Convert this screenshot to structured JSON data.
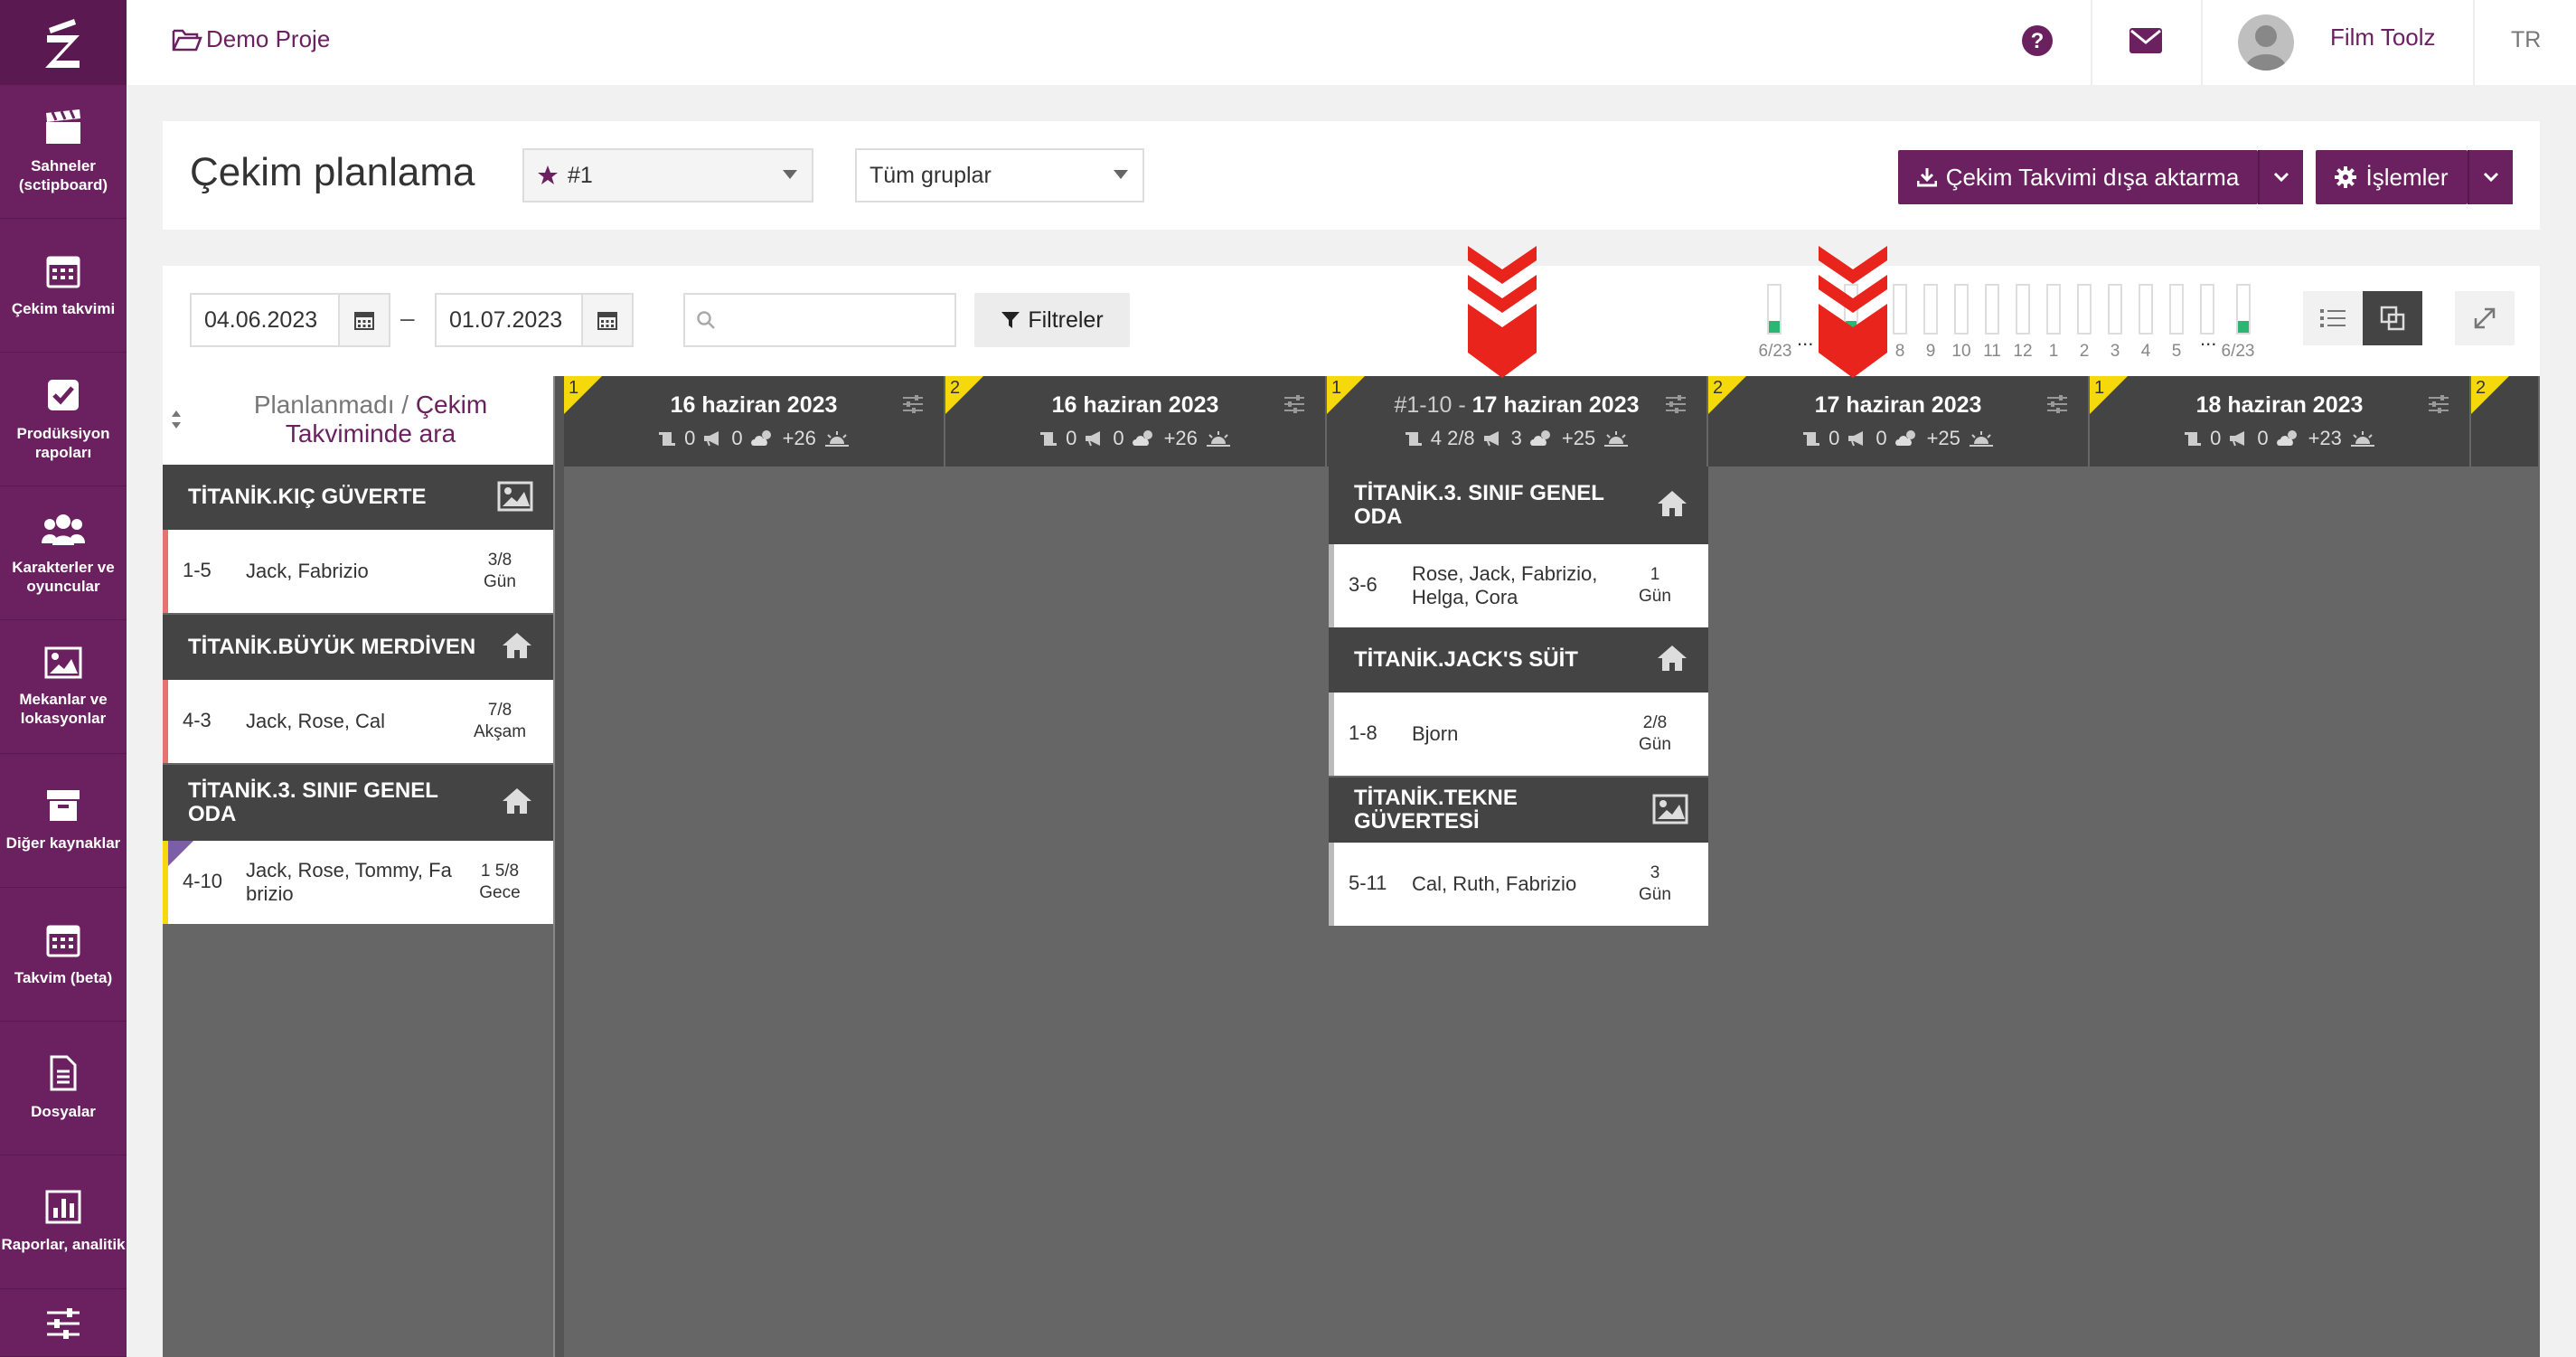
{
  "sidebar": {
    "items": [
      {
        "label": "Sahneler (sctipboard)",
        "icon": "clapperboard-icon"
      },
      {
        "label": "Çekim takvimi",
        "icon": "calendar-icon"
      },
      {
        "label": "Prodüksiyon rapoları",
        "icon": "checkbox-icon"
      },
      {
        "label": "Karakterler ve oyuncular",
        "icon": "users-icon"
      },
      {
        "label": "Mekanlar ve lokasyonlar",
        "icon": "image-icon"
      },
      {
        "label": "Diğer kaynaklar",
        "icon": "archive-icon"
      },
      {
        "label": "Takvim (beta)",
        "icon": "calendar-icon"
      },
      {
        "label": "Dosyalar",
        "icon": "file-icon"
      },
      {
        "label": "Raporlar, analitik",
        "icon": "bar-chart-icon"
      },
      {
        "label": "",
        "icon": "sliders-icon"
      }
    ]
  },
  "topbar": {
    "project": "Demo Proje",
    "username": "Film Toolz",
    "language": "TR"
  },
  "header": {
    "title": "Çekim planlama",
    "schedule_select": "#1",
    "group_select": "Tüm gruplar",
    "export_button": "Çekim Takvimi dışa aktarma",
    "actions_button": "İşlemler"
  },
  "filters": {
    "date_from": "04.06.2023",
    "date_to": "01.07.2023",
    "separator": "–",
    "search_placeholder": "",
    "filter_button": "Filtreler"
  },
  "minimap": {
    "left_label": "6/23",
    "right_label": "6/23",
    "ellipsis": "...",
    "days": [
      "8",
      "9",
      "10",
      "11",
      "12",
      "1",
      "2",
      "3",
      "4",
      "5"
    ],
    "fills": [
      0.25,
      0.25,
      0,
      0,
      0,
      0,
      0,
      0,
      0,
      0,
      0,
      0,
      0,
      0.25
    ]
  },
  "unplanned": {
    "title_plain": "Planlanmadı /",
    "title_link": "Çekim Takviminde ara",
    "groups": [
      {
        "name": "TİTANİK.KIÇ GÜVERTE",
        "icon": "image-icon",
        "scenes": [
          {
            "num": "1-5",
            "chars": "Jack, Fabrizio",
            "eighths": "3/8",
            "time": "Gün",
            "color": "#e57373"
          }
        ]
      },
      {
        "name": "TİTANİK.BÜYÜK MERDİVEN",
        "icon": "home-icon",
        "scenes": [
          {
            "num": "4-3",
            "chars": "Jack, Rose, Cal",
            "eighths": "7/8",
            "time": "Akşam",
            "color": "#e57373"
          }
        ]
      },
      {
        "name": "TİTANİK.3. SINIF GENEL ODA",
        "icon": "home-icon",
        "scenes": [
          {
            "num": "4-10",
            "chars": "Jack, Rose, Tommy, Fa brizio",
            "eighths": "1 5/8",
            "time": "Gece",
            "color": "#f5d90a"
          }
        ]
      }
    ]
  },
  "columns": [
    {
      "badge": "1",
      "prefix": "",
      "date": "16 haziran 2023",
      "stat_pages": "0",
      "stat_scenes": "0",
      "stat_cast": "+26"
    },
    {
      "badge": "2",
      "prefix": "",
      "date": "16 haziran 2023",
      "stat_pages": "0",
      "stat_scenes": "0",
      "stat_cast": "+26"
    },
    {
      "badge": "1",
      "prefix": "#1-10 - ",
      "date": "17 haziran 2023",
      "stat_pages": "4 2/8",
      "stat_scenes": "3",
      "stat_cast": "+25"
    },
    {
      "badge": "2",
      "prefix": "",
      "date": "17 haziran 2023",
      "stat_pages": "0",
      "stat_scenes": "0",
      "stat_cast": "+25"
    },
    {
      "badge": "1",
      "prefix": "",
      "date": "18 haziran 2023",
      "stat_pages": "0",
      "stat_scenes": "0",
      "stat_cast": "+23"
    },
    {
      "badge": "2",
      "prefix": "",
      "date": "",
      "stat_pages": "",
      "stat_scenes": "",
      "stat_cast": ""
    }
  ],
  "scheduled": {
    "groups": [
      {
        "name": "TİTANİK.3. SINIF GENEL ODA",
        "icon": "home-icon",
        "scene": {
          "num": "3-6",
          "chars": "Rose, Jack, Fabrizio, Helga, Cora",
          "eighths": "1",
          "time": "Gün"
        }
      },
      {
        "name": "TİTANİK.JACK'S SÜİT",
        "icon": "home-icon",
        "scene": {
          "num": "1-8",
          "chars": "Bjorn",
          "eighths": "2/8",
          "time": "Gün"
        }
      },
      {
        "name": "TİTANİK.TEKNE GÜVERTESİ",
        "icon": "image-icon",
        "scene": {
          "num": "5-11",
          "chars": "Cal, Ruth, Fabrizio",
          "eighths": "3",
          "time": "Gün"
        }
      }
    ]
  },
  "colors": {
    "brand": "#6b2160",
    "annotation_arrow": "#e8241c",
    "badge": "#f5d90a"
  }
}
